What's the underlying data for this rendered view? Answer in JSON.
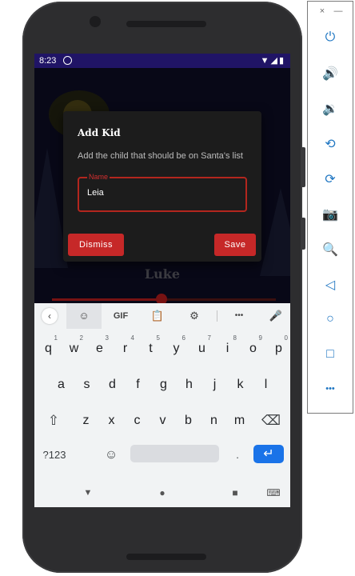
{
  "status_bar": {
    "time": "8:23",
    "indicators": "▼◢▮"
  },
  "background_scene": {
    "kid_name": "Luke",
    "slider_value": 0.49,
    "colors": {
      "sky": "#0d0d24",
      "accent": "#b71c1c"
    }
  },
  "dialog": {
    "title": "Add Kid",
    "message": "Add the child that should be on Santa's list",
    "field_label": "Name",
    "field_value": "Leia",
    "dismiss_label": "Dismiss",
    "save_label": "Save"
  },
  "keyboard": {
    "toolbar": {
      "back_icon": "‹",
      "sticker_icon": "☺",
      "gif_label": "GIF",
      "clipboard_icon": "📋",
      "settings_icon": "⚙",
      "more_icon": "•••",
      "mic_icon": "🎤"
    },
    "row1": [
      {
        "k": "q",
        "h": "1"
      },
      {
        "k": "w",
        "h": "2"
      },
      {
        "k": "e",
        "h": "3"
      },
      {
        "k": "r",
        "h": "4"
      },
      {
        "k": "t",
        "h": "5"
      },
      {
        "k": "y",
        "h": "6"
      },
      {
        "k": "u",
        "h": "7"
      },
      {
        "k": "i",
        "h": "8"
      },
      {
        "k": "o",
        "h": "9"
      },
      {
        "k": "p",
        "h": "0"
      }
    ],
    "row2": [
      "a",
      "s",
      "d",
      "f",
      "g",
      "h",
      "j",
      "k",
      "l"
    ],
    "row3": [
      "z",
      "x",
      "c",
      "v",
      "b",
      "n",
      "m"
    ],
    "shift_icon": "⇧",
    "backspace_icon": "⌫",
    "symbols_label": "?123",
    "emoji_icon": "☺",
    "period": ".",
    "enter_icon": "↵"
  },
  "nav_bar": {
    "back": "▼",
    "home": "●",
    "recents": "■",
    "kbd_switch": "⌨"
  },
  "emulator_panel": {
    "close": "×",
    "minimize": "—",
    "power": "⏻",
    "volume_up": "🔊",
    "volume_down": "🔉",
    "rotate_left": "⟲",
    "rotate_right": "⟳",
    "screenshot": "📷",
    "zoom": "🔍",
    "back": "◁",
    "home": "○",
    "overview": "□",
    "more": "•••"
  }
}
